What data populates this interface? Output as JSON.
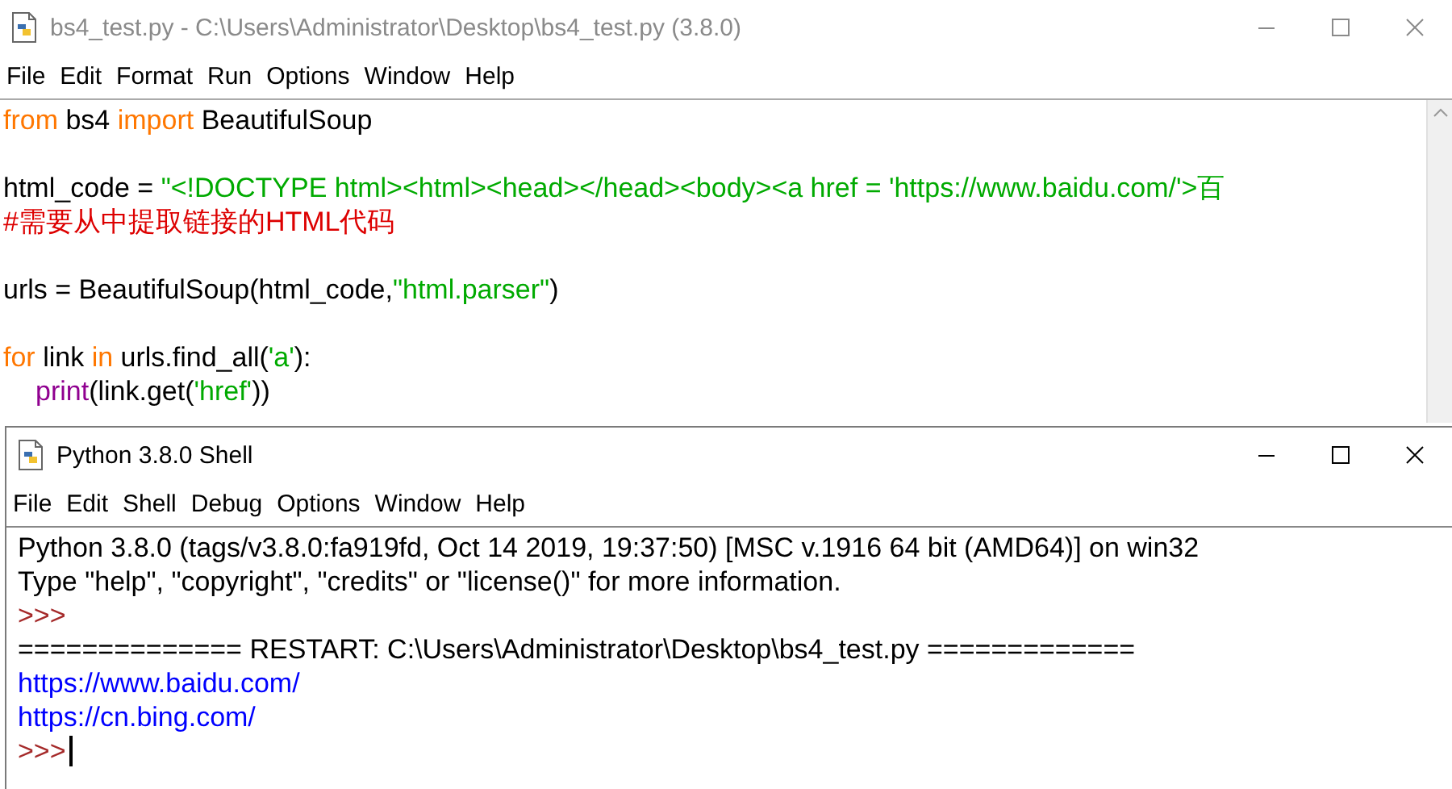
{
  "editor": {
    "title": "bs4_test.py - C:\\Users\\Administrator\\Desktop\\bs4_test.py (3.8.0)",
    "active": false,
    "menu": [
      "File",
      "Edit",
      "Format",
      "Run",
      "Options",
      "Window",
      "Help"
    ],
    "lines": [
      {
        "kind": "code",
        "tokens": [
          {
            "kind": "keyword",
            "text": "from"
          },
          {
            "kind": "plain",
            "text": " bs4 "
          },
          {
            "kind": "keyword",
            "text": "import"
          },
          {
            "kind": "plain",
            "text": " BeautifulSoup"
          }
        ]
      },
      {
        "kind": "blank"
      },
      {
        "kind": "code",
        "tokens": [
          {
            "kind": "plain",
            "text": "html_code = "
          },
          {
            "kind": "string",
            "text": "\"<!DOCTYPE html><html><head></head><body><a href = 'https://www.baidu.com/'>百"
          }
        ]
      },
      {
        "kind": "code",
        "tokens": [
          {
            "kind": "comment",
            "text": "#需要从中提取链接的HTML代码"
          }
        ]
      },
      {
        "kind": "blank"
      },
      {
        "kind": "code",
        "tokens": [
          {
            "kind": "plain",
            "text": "urls = BeautifulSoup(html_code,"
          },
          {
            "kind": "string",
            "text": "\"html.parser\""
          },
          {
            "kind": "plain",
            "text": ")"
          }
        ]
      },
      {
        "kind": "blank"
      },
      {
        "kind": "code",
        "tokens": [
          {
            "kind": "keyword",
            "text": "for"
          },
          {
            "kind": "plain",
            "text": " link "
          },
          {
            "kind": "keyword",
            "text": "in"
          },
          {
            "kind": "plain",
            "text": " urls.find_all("
          },
          {
            "kind": "string",
            "text": "'a'"
          },
          {
            "kind": "plain",
            "text": "):"
          }
        ]
      },
      {
        "kind": "code",
        "indent": true,
        "tokens": [
          {
            "kind": "builtin",
            "text": "print"
          },
          {
            "kind": "plain",
            "text": "(link.get("
          },
          {
            "kind": "string",
            "text": "'href'"
          },
          {
            "kind": "plain",
            "text": "))"
          }
        ]
      }
    ]
  },
  "shell": {
    "title": "Python 3.8.0 Shell",
    "active": true,
    "menu": [
      "File",
      "Edit",
      "Shell",
      "Debug",
      "Options",
      "Window",
      "Help"
    ],
    "lines": [
      {
        "kind": "output",
        "text": "Python 3.8.0 (tags/v3.8.0:fa919fd, Oct 14 2019, 19:37:50) [MSC v.1916 64 bit (AMD64)] on win32"
      },
      {
        "kind": "output",
        "text": "Type \"help\", \"copyright\", \"credits\" or \"license()\" for more information."
      },
      {
        "kind": "prompt",
        "text": ">>>"
      },
      {
        "kind": "output",
        "text": "============== RESTART: C:\\Users\\Administrator\\Desktop\\bs4_test.py ============="
      },
      {
        "kind": "stdout",
        "text": "https://www.baidu.com/"
      },
      {
        "kind": "stdout",
        "text": "https://cn.bing.com/"
      },
      {
        "kind": "prompt",
        "text": ">>>",
        "cursor": true
      }
    ]
  }
}
